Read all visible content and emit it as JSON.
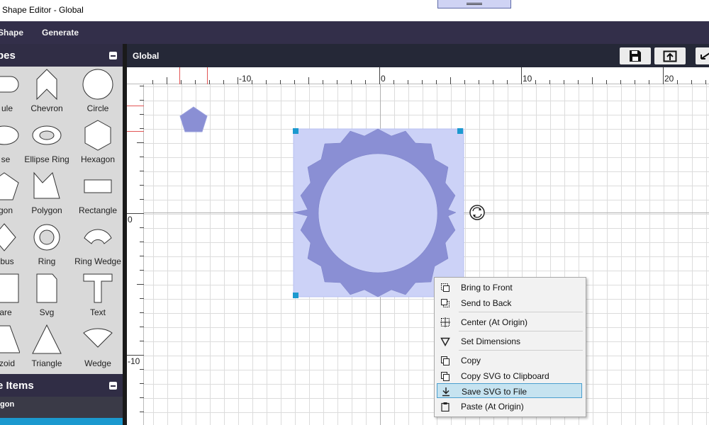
{
  "window": {
    "title": "Shape Editor - Global"
  },
  "menu": {
    "items": [
      "Shape",
      "Generate"
    ]
  },
  "shapes_panel": {
    "title": "Shapes",
    "visible_title": "pes",
    "tiles": [
      {
        "label": "Capsule",
        "visible": "ule",
        "icon": "capsule-icon"
      },
      {
        "label": "Chevron",
        "visible": "Chevron",
        "icon": "chevron-icon"
      },
      {
        "label": "Circle",
        "visible": "Circle",
        "icon": "circle-icon"
      },
      {
        "label": "Ellipse",
        "visible": "se",
        "icon": "ellipse-icon"
      },
      {
        "label": "Ellipse Ring",
        "visible": "Ellipse Ring",
        "icon": "ellipse-ring-icon"
      },
      {
        "label": "Hexagon",
        "visible": "Hexagon",
        "icon": "hexagon-icon"
      },
      {
        "label": "Pentagon",
        "visible": "gon",
        "icon": "pentagon-icon"
      },
      {
        "label": "Polygon",
        "visible": "Polygon",
        "icon": "polygon-icon"
      },
      {
        "label": "Rectangle",
        "visible": "Rectangle",
        "icon": "rectangle-icon"
      },
      {
        "label": "Rhombus",
        "visible": "bus",
        "icon": "rhombus-icon"
      },
      {
        "label": "Ring",
        "visible": "Ring",
        "icon": "ring-icon"
      },
      {
        "label": "Ring Wedge",
        "visible": "Ring Wedge",
        "icon": "ring-wedge-icon"
      },
      {
        "label": "Square",
        "visible": "are",
        "icon": "square-icon"
      },
      {
        "label": "Svg",
        "visible": "Svg",
        "icon": "svg-icon"
      },
      {
        "label": "Text",
        "visible": "Text",
        "icon": "text-icon"
      },
      {
        "label": "Trapezoid",
        "visible": "zoid",
        "icon": "trapezoid-icon"
      },
      {
        "label": "Triangle",
        "visible": "Triangle",
        "icon": "triangle-icon"
      },
      {
        "label": "Wedge",
        "visible": "Wedge",
        "icon": "wedge-icon"
      }
    ]
  },
  "items_panel": {
    "title": "Shape Items",
    "visible_title": "e Items",
    "row": "Polygon",
    "visible_row": "gon"
  },
  "document": {
    "tab": "Global",
    "toolbar": [
      "save-icon",
      "export-icon",
      "undo-icon"
    ]
  },
  "ruler": {
    "h_labels": [
      "-10",
      "0",
      "10",
      "20"
    ],
    "v_labels": [
      "0",
      "-10"
    ]
  },
  "colors": {
    "shape_fill": "#8a8fd4",
    "selection_fill": "#ccd2f7",
    "handle": "#1b99cf",
    "menubar": "#332f4a"
  },
  "context_menu": {
    "items": [
      {
        "label": "Bring to Front",
        "icon": "bring-to-front-icon"
      },
      {
        "label": "Send to Back",
        "icon": "send-to-back-icon"
      },
      {
        "label": "Center (At Origin)",
        "icon": "center-icon"
      },
      {
        "label": "Set Dimensions",
        "icon": "set-dimensions-icon"
      },
      {
        "label": "Copy",
        "icon": "copy-icon"
      },
      {
        "label": "Copy SVG to Clipboard",
        "icon": "copy-svg-icon"
      },
      {
        "label": "Save SVG to File",
        "icon": "save-svg-icon",
        "highlighted": true
      },
      {
        "label": "Paste (At Origin)",
        "icon": "paste-icon"
      }
    ]
  }
}
